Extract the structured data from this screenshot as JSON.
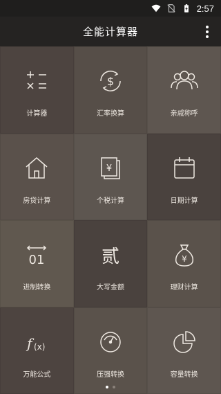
{
  "status": {
    "time": "2:57"
  },
  "appbar": {
    "title": "全能计算器",
    "menu_icon": "more-vert-icon"
  },
  "tiles": [
    {
      "label": "计算器",
      "icon": "calculator-icon",
      "color": "#4d4440"
    },
    {
      "label": "汇率换算",
      "icon": "currency-exchange-icon",
      "color": "#564e48"
    },
    {
      "label": "亲戚称呼",
      "icon": "people-icon",
      "color": "#5e5650"
    },
    {
      "label": "房贷计算",
      "icon": "house-icon",
      "color": "#5a514b"
    },
    {
      "label": "个税计算",
      "icon": "tax-document-icon",
      "color": "#5d5650"
    },
    {
      "label": "日期计算",
      "icon": "calendar-icon",
      "color": "#4a423e"
    },
    {
      "label": "进制转换",
      "icon": "binary-icon",
      "color": "#60584f"
    },
    {
      "label": "大写金额",
      "icon": "chinese-numeral-icon",
      "color": "#4a423e"
    },
    {
      "label": "理财计算",
      "icon": "money-bag-icon",
      "color": "#5a524b"
    },
    {
      "label": "万能公式",
      "icon": "formula-icon",
      "color": "#4d4440"
    },
    {
      "label": "压强转换",
      "icon": "gauge-icon",
      "color": "#5a524b"
    },
    {
      "label": "容量转换",
      "icon": "pie-chart-icon",
      "color": "#5e5650"
    }
  ],
  "pager": {
    "pages": 2,
    "current": 1
  }
}
